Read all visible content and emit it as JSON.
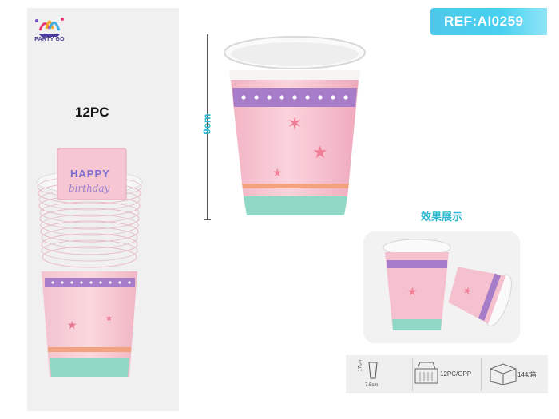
{
  "brand": {
    "logo_text": "PARTY GO"
  },
  "product": {
    "quantity_label": "12PC",
    "ref_label": "REF:AI0259",
    "height_label": "9cm",
    "cup_print_text": [
      "HAPPY",
      "birthday"
    ]
  },
  "effect": {
    "title": "效果展示"
  },
  "specs": {
    "size_height": "17cm",
    "size_width": "7.5cm",
    "pack_label": "12PC/OPP",
    "carton_label": "144/箱"
  },
  "colors": {
    "accent": "#49d0f0",
    "cup_pink": "#f6b7c8",
    "cup_purple": "#a77cc9",
    "cup_mint": "#8fd8c6"
  }
}
